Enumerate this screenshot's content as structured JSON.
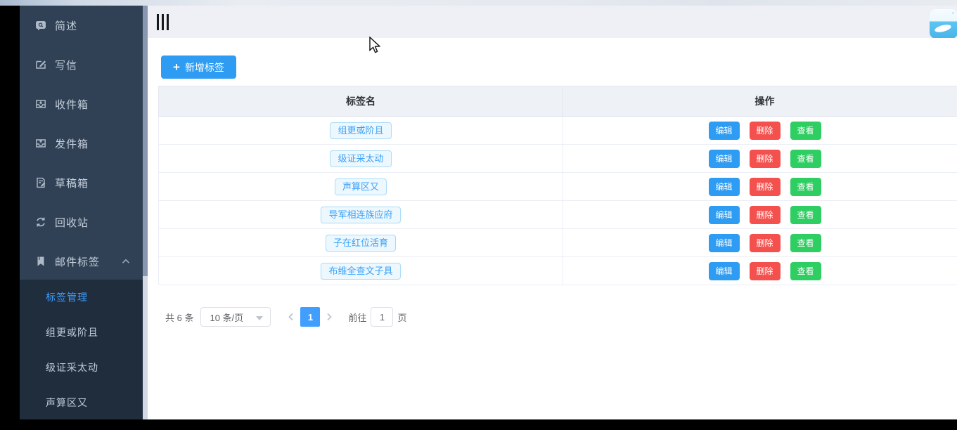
{
  "sidebar": {
    "items": [
      {
        "id": "overview",
        "icon": "chat-bubble-icon",
        "label": "简述"
      },
      {
        "id": "compose",
        "icon": "compose-icon",
        "label": "写信"
      },
      {
        "id": "inbox",
        "icon": "inbox-icon",
        "label": "收件箱"
      },
      {
        "id": "outbox",
        "icon": "outbox-icon",
        "label": "发件箱"
      },
      {
        "id": "drafts",
        "icon": "draft-icon",
        "label": "草稿箱"
      },
      {
        "id": "trash",
        "icon": "recycle-icon",
        "label": "回收站"
      },
      {
        "id": "mail-tags",
        "icon": "bookmark-icon",
        "label": "邮件标签",
        "expanded": true
      }
    ],
    "submenu": [
      {
        "id": "tag-management",
        "label": "标签管理",
        "active": true
      },
      {
        "id": "tag-1",
        "label": "组更或阶且",
        "active": false
      },
      {
        "id": "tag-2",
        "label": "级证采太动",
        "active": false
      },
      {
        "id": "tag-3",
        "label": "声算区又",
        "active": false
      }
    ]
  },
  "header": {
    "hamburger_icon": "hamburger-icon",
    "avatar_icon": "user-avatar"
  },
  "toolbar": {
    "add_icon_char": "+",
    "add_label": "新增标签"
  },
  "table": {
    "columns": [
      "标签名",
      "操作"
    ],
    "rows": [
      {
        "tag": "组更或阶且"
      },
      {
        "tag": "级证采太动"
      },
      {
        "tag": "声算区又"
      },
      {
        "tag": "导军相连族应府"
      },
      {
        "tag": "子在红位活育"
      },
      {
        "tag": "布维全查文子具"
      }
    ],
    "actions": [
      {
        "id": "edit",
        "label": "编辑",
        "color": "#2d9cf2"
      },
      {
        "id": "delete",
        "label": "删除",
        "color": "#f4504d"
      },
      {
        "id": "view",
        "label": "查看",
        "color": "#2fce62"
      }
    ]
  },
  "pagination": {
    "total_text": "共 6 条",
    "page_size_value": "10 条/页",
    "prev_icon": "arrow-left-icon",
    "next_icon": "arrow-right-icon",
    "current_page": "1",
    "goto_label": "前往",
    "goto_value": "1",
    "page_unit": "页"
  },
  "colors": {
    "primary": "#2d9cf2",
    "danger": "#f4504d",
    "success": "#2fce62",
    "pager_active": "#409eff",
    "sidebar_bg": "#304156",
    "submenu_bg": "#1f2d3d",
    "sidebar_text": "#c5cfdb",
    "active_link": "#409eff",
    "tag_bg": "#edf7fe",
    "tag_border": "#a9dcf7",
    "tag_text": "#38a2f8",
    "header_bg": "#eef0f5"
  }
}
